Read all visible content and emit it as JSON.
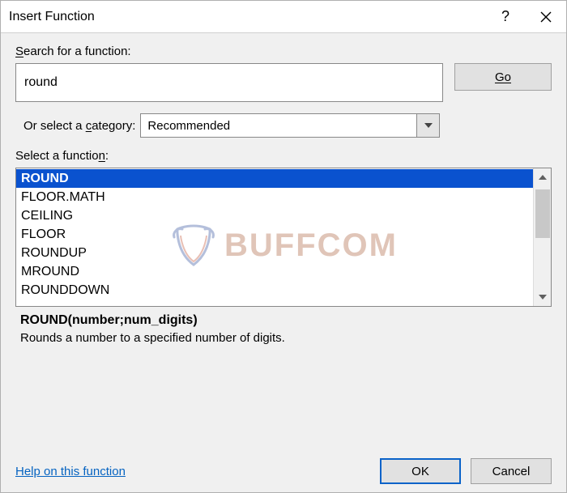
{
  "titlebar": {
    "title": "Insert Function"
  },
  "search": {
    "label_pre": "S",
    "label_post": "earch for a function:",
    "value": "round",
    "go_label": "G",
    "go_label_post": "o"
  },
  "category": {
    "label_pre": "Or select a ",
    "label_mid": "c",
    "label_post": "ategory:",
    "selected": "Recommended"
  },
  "functions": {
    "label_pre": "Select a functio",
    "label_mid": "n",
    "label_post": ":",
    "items": [
      "ROUND",
      "FLOOR.MATH",
      "CEILING",
      "FLOOR",
      "ROUNDUP",
      "MROUND",
      "ROUNDDOWN"
    ],
    "selected_index": 0,
    "signature": "ROUND(number;num_digits)",
    "description": "Rounds a number to a specified number of digits."
  },
  "footer": {
    "help_link": "Help on this function",
    "ok": "OK",
    "cancel": "Cancel"
  },
  "watermark": {
    "text": "BUFFCOM"
  }
}
